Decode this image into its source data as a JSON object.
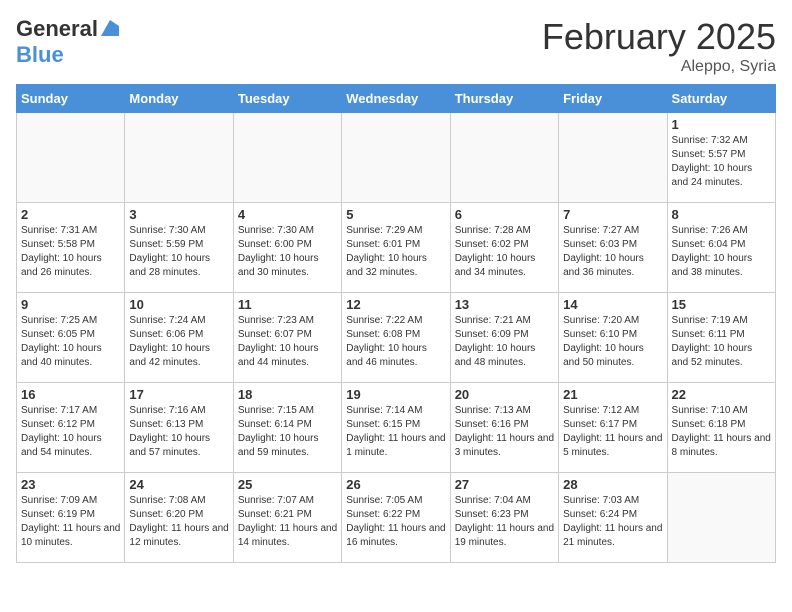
{
  "header": {
    "logo_general": "General",
    "logo_blue": "Blue",
    "title": "February 2025",
    "subtitle": "Aleppo, Syria"
  },
  "days_of_week": [
    "Sunday",
    "Monday",
    "Tuesday",
    "Wednesday",
    "Thursday",
    "Friday",
    "Saturday"
  ],
  "weeks": [
    [
      {
        "day": "",
        "info": ""
      },
      {
        "day": "",
        "info": ""
      },
      {
        "day": "",
        "info": ""
      },
      {
        "day": "",
        "info": ""
      },
      {
        "day": "",
        "info": ""
      },
      {
        "day": "",
        "info": ""
      },
      {
        "day": "1",
        "info": "Sunrise: 7:32 AM\nSunset: 5:57 PM\nDaylight: 10 hours and 24 minutes."
      }
    ],
    [
      {
        "day": "2",
        "info": "Sunrise: 7:31 AM\nSunset: 5:58 PM\nDaylight: 10 hours and 26 minutes."
      },
      {
        "day": "3",
        "info": "Sunrise: 7:30 AM\nSunset: 5:59 PM\nDaylight: 10 hours and 28 minutes."
      },
      {
        "day": "4",
        "info": "Sunrise: 7:30 AM\nSunset: 6:00 PM\nDaylight: 10 hours and 30 minutes."
      },
      {
        "day": "5",
        "info": "Sunrise: 7:29 AM\nSunset: 6:01 PM\nDaylight: 10 hours and 32 minutes."
      },
      {
        "day": "6",
        "info": "Sunrise: 7:28 AM\nSunset: 6:02 PM\nDaylight: 10 hours and 34 minutes."
      },
      {
        "day": "7",
        "info": "Sunrise: 7:27 AM\nSunset: 6:03 PM\nDaylight: 10 hours and 36 minutes."
      },
      {
        "day": "8",
        "info": "Sunrise: 7:26 AM\nSunset: 6:04 PM\nDaylight: 10 hours and 38 minutes."
      }
    ],
    [
      {
        "day": "9",
        "info": "Sunrise: 7:25 AM\nSunset: 6:05 PM\nDaylight: 10 hours and 40 minutes."
      },
      {
        "day": "10",
        "info": "Sunrise: 7:24 AM\nSunset: 6:06 PM\nDaylight: 10 hours and 42 minutes."
      },
      {
        "day": "11",
        "info": "Sunrise: 7:23 AM\nSunset: 6:07 PM\nDaylight: 10 hours and 44 minutes."
      },
      {
        "day": "12",
        "info": "Sunrise: 7:22 AM\nSunset: 6:08 PM\nDaylight: 10 hours and 46 minutes."
      },
      {
        "day": "13",
        "info": "Sunrise: 7:21 AM\nSunset: 6:09 PM\nDaylight: 10 hours and 48 minutes."
      },
      {
        "day": "14",
        "info": "Sunrise: 7:20 AM\nSunset: 6:10 PM\nDaylight: 10 hours and 50 minutes."
      },
      {
        "day": "15",
        "info": "Sunrise: 7:19 AM\nSunset: 6:11 PM\nDaylight: 10 hours and 52 minutes."
      }
    ],
    [
      {
        "day": "16",
        "info": "Sunrise: 7:17 AM\nSunset: 6:12 PM\nDaylight: 10 hours and 54 minutes."
      },
      {
        "day": "17",
        "info": "Sunrise: 7:16 AM\nSunset: 6:13 PM\nDaylight: 10 hours and 57 minutes."
      },
      {
        "day": "18",
        "info": "Sunrise: 7:15 AM\nSunset: 6:14 PM\nDaylight: 10 hours and 59 minutes."
      },
      {
        "day": "19",
        "info": "Sunrise: 7:14 AM\nSunset: 6:15 PM\nDaylight: 11 hours and 1 minute."
      },
      {
        "day": "20",
        "info": "Sunrise: 7:13 AM\nSunset: 6:16 PM\nDaylight: 11 hours and 3 minutes."
      },
      {
        "day": "21",
        "info": "Sunrise: 7:12 AM\nSunset: 6:17 PM\nDaylight: 11 hours and 5 minutes."
      },
      {
        "day": "22",
        "info": "Sunrise: 7:10 AM\nSunset: 6:18 PM\nDaylight: 11 hours and 8 minutes."
      }
    ],
    [
      {
        "day": "23",
        "info": "Sunrise: 7:09 AM\nSunset: 6:19 PM\nDaylight: 11 hours and 10 minutes."
      },
      {
        "day": "24",
        "info": "Sunrise: 7:08 AM\nSunset: 6:20 PM\nDaylight: 11 hours and 12 minutes."
      },
      {
        "day": "25",
        "info": "Sunrise: 7:07 AM\nSunset: 6:21 PM\nDaylight: 11 hours and 14 minutes."
      },
      {
        "day": "26",
        "info": "Sunrise: 7:05 AM\nSunset: 6:22 PM\nDaylight: 11 hours and 16 minutes."
      },
      {
        "day": "27",
        "info": "Sunrise: 7:04 AM\nSunset: 6:23 PM\nDaylight: 11 hours and 19 minutes."
      },
      {
        "day": "28",
        "info": "Sunrise: 7:03 AM\nSunset: 6:24 PM\nDaylight: 11 hours and 21 minutes."
      },
      {
        "day": "",
        "info": ""
      }
    ]
  ]
}
